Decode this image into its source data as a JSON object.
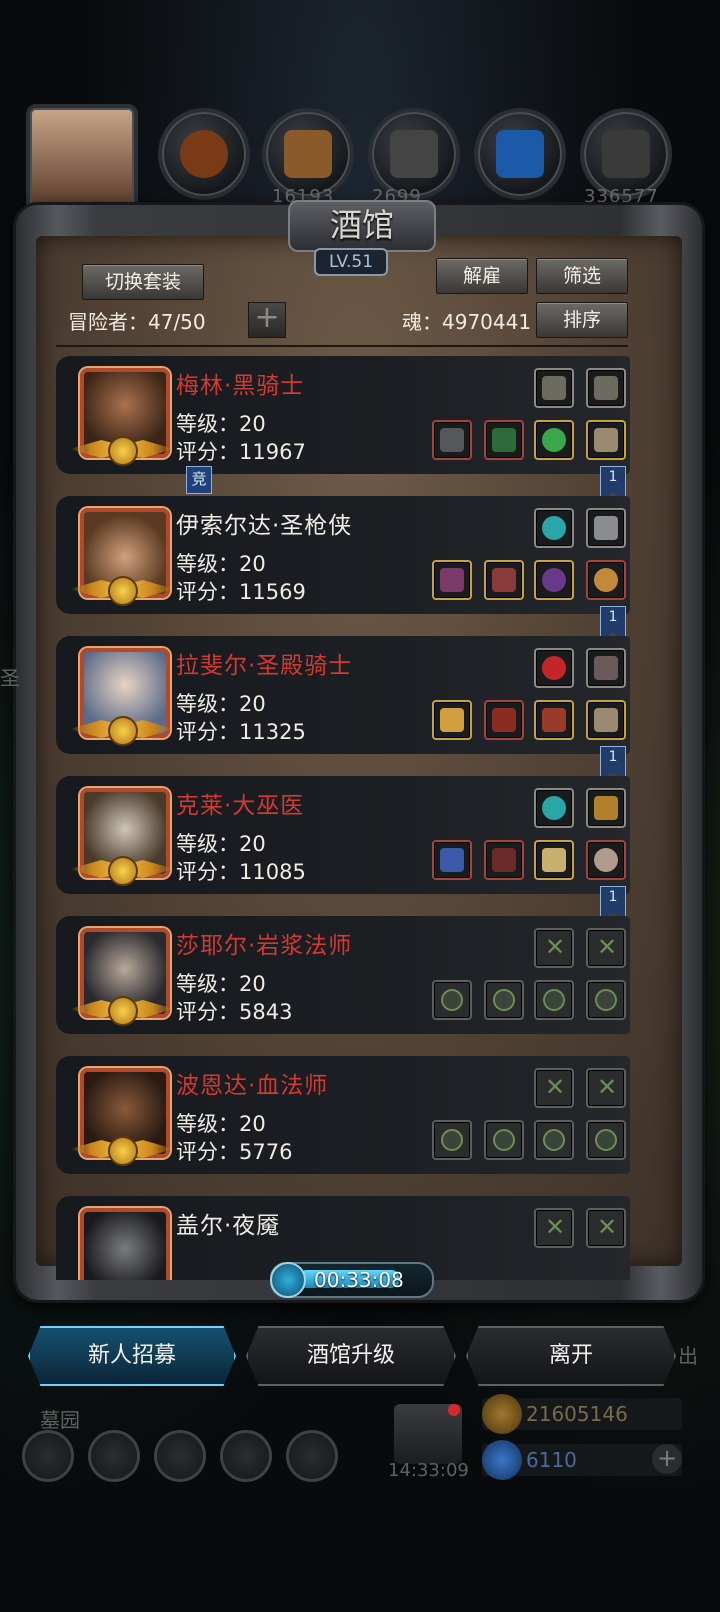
{
  "top_strip": {
    "resource_fragments": [
      "16193",
      "2699",
      "336577"
    ]
  },
  "window": {
    "title": "酒馆",
    "level": "LV.51"
  },
  "toolbar": {
    "switch_outfit": "切换套装",
    "dismiss": "解雇",
    "filter": "筛选",
    "sort": "排序",
    "adventurers_label": "冒险者：47/50",
    "soul_label": "魂：4970441",
    "add_symbol": "+"
  },
  "heroes": [
    {
      "name": "梅林·黑骑士",
      "name_color": "red",
      "level": "等级：20",
      "score": "评分：11967",
      "badge": "竞",
      "flag": "1"
    },
    {
      "name": "伊索尔达·圣枪侠",
      "name_color": "white",
      "level": "等级：20",
      "score": "评分：11569",
      "flag": "1"
    },
    {
      "name": "拉斐尔·圣殿骑士",
      "name_color": "red",
      "level": "等级：20",
      "score": "评分：11325",
      "flag": "1"
    },
    {
      "name": "克莱·大巫医",
      "name_color": "red",
      "level": "等级：20",
      "score": "评分：11085",
      "flag": "1"
    },
    {
      "name": "莎耶尔·岩浆法师",
      "name_color": "red",
      "level": "等级：20",
      "score": "评分：5843"
    },
    {
      "name": "波恩达·血法师",
      "name_color": "red",
      "level": "等级：20",
      "score": "评分：5776"
    },
    {
      "name": "盖尔·夜魇",
      "name_color": "white"
    }
  ],
  "timer": {
    "value": "00:33:08"
  },
  "actions": {
    "recruit": "新人招募",
    "upgrade": "酒馆升级",
    "leave": "离开"
  },
  "bottom": {
    "graveyard": "墓园",
    "clock": "14:33:09",
    "gold": "21605146",
    "gems": "6110",
    "side_left": "圣",
    "side_right": "出"
  },
  "colors": {
    "name_red": "#d23a32",
    "accent_blue": "#36b2ee",
    "gold_text": "#7a6a46"
  }
}
